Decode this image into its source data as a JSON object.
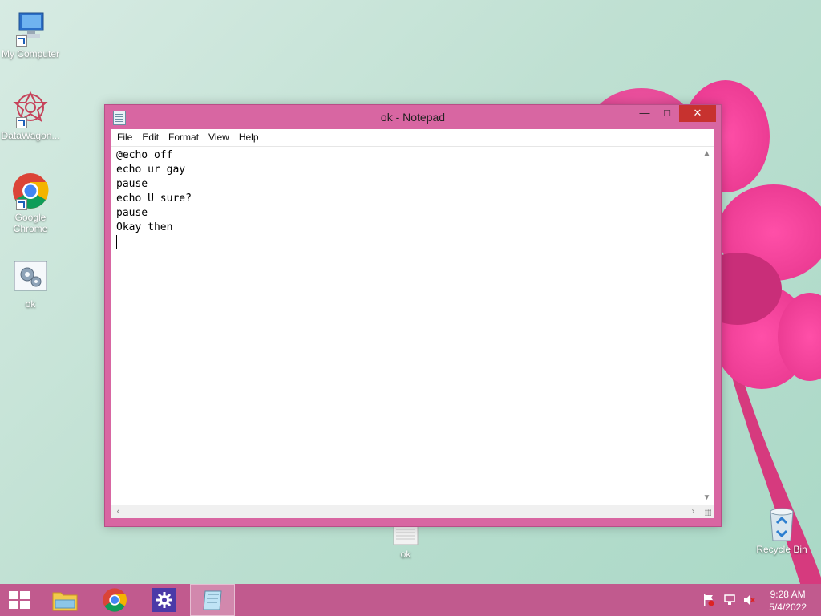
{
  "desktop": {
    "icons": [
      {
        "label": "My Computer"
      },
      {
        "label": "DataWagon..."
      },
      {
        "label": "Google Chrome"
      },
      {
        "label": "ok"
      },
      {
        "label": "ok"
      },
      {
        "label": "Recycle Bin"
      }
    ]
  },
  "window": {
    "title": "ok - Notepad",
    "menu": [
      "File",
      "Edit",
      "Format",
      "View",
      "Help"
    ],
    "content": "@echo off\necho ur gay\npause\necho U sure?\npause\nOkay then\n"
  },
  "taskbar": {
    "time": "9:28 AM",
    "date": "5/4/2022"
  },
  "colors": {
    "window_frame": "#d866a2",
    "taskbar": "#c15a8e",
    "close_button": "#c7322f"
  }
}
